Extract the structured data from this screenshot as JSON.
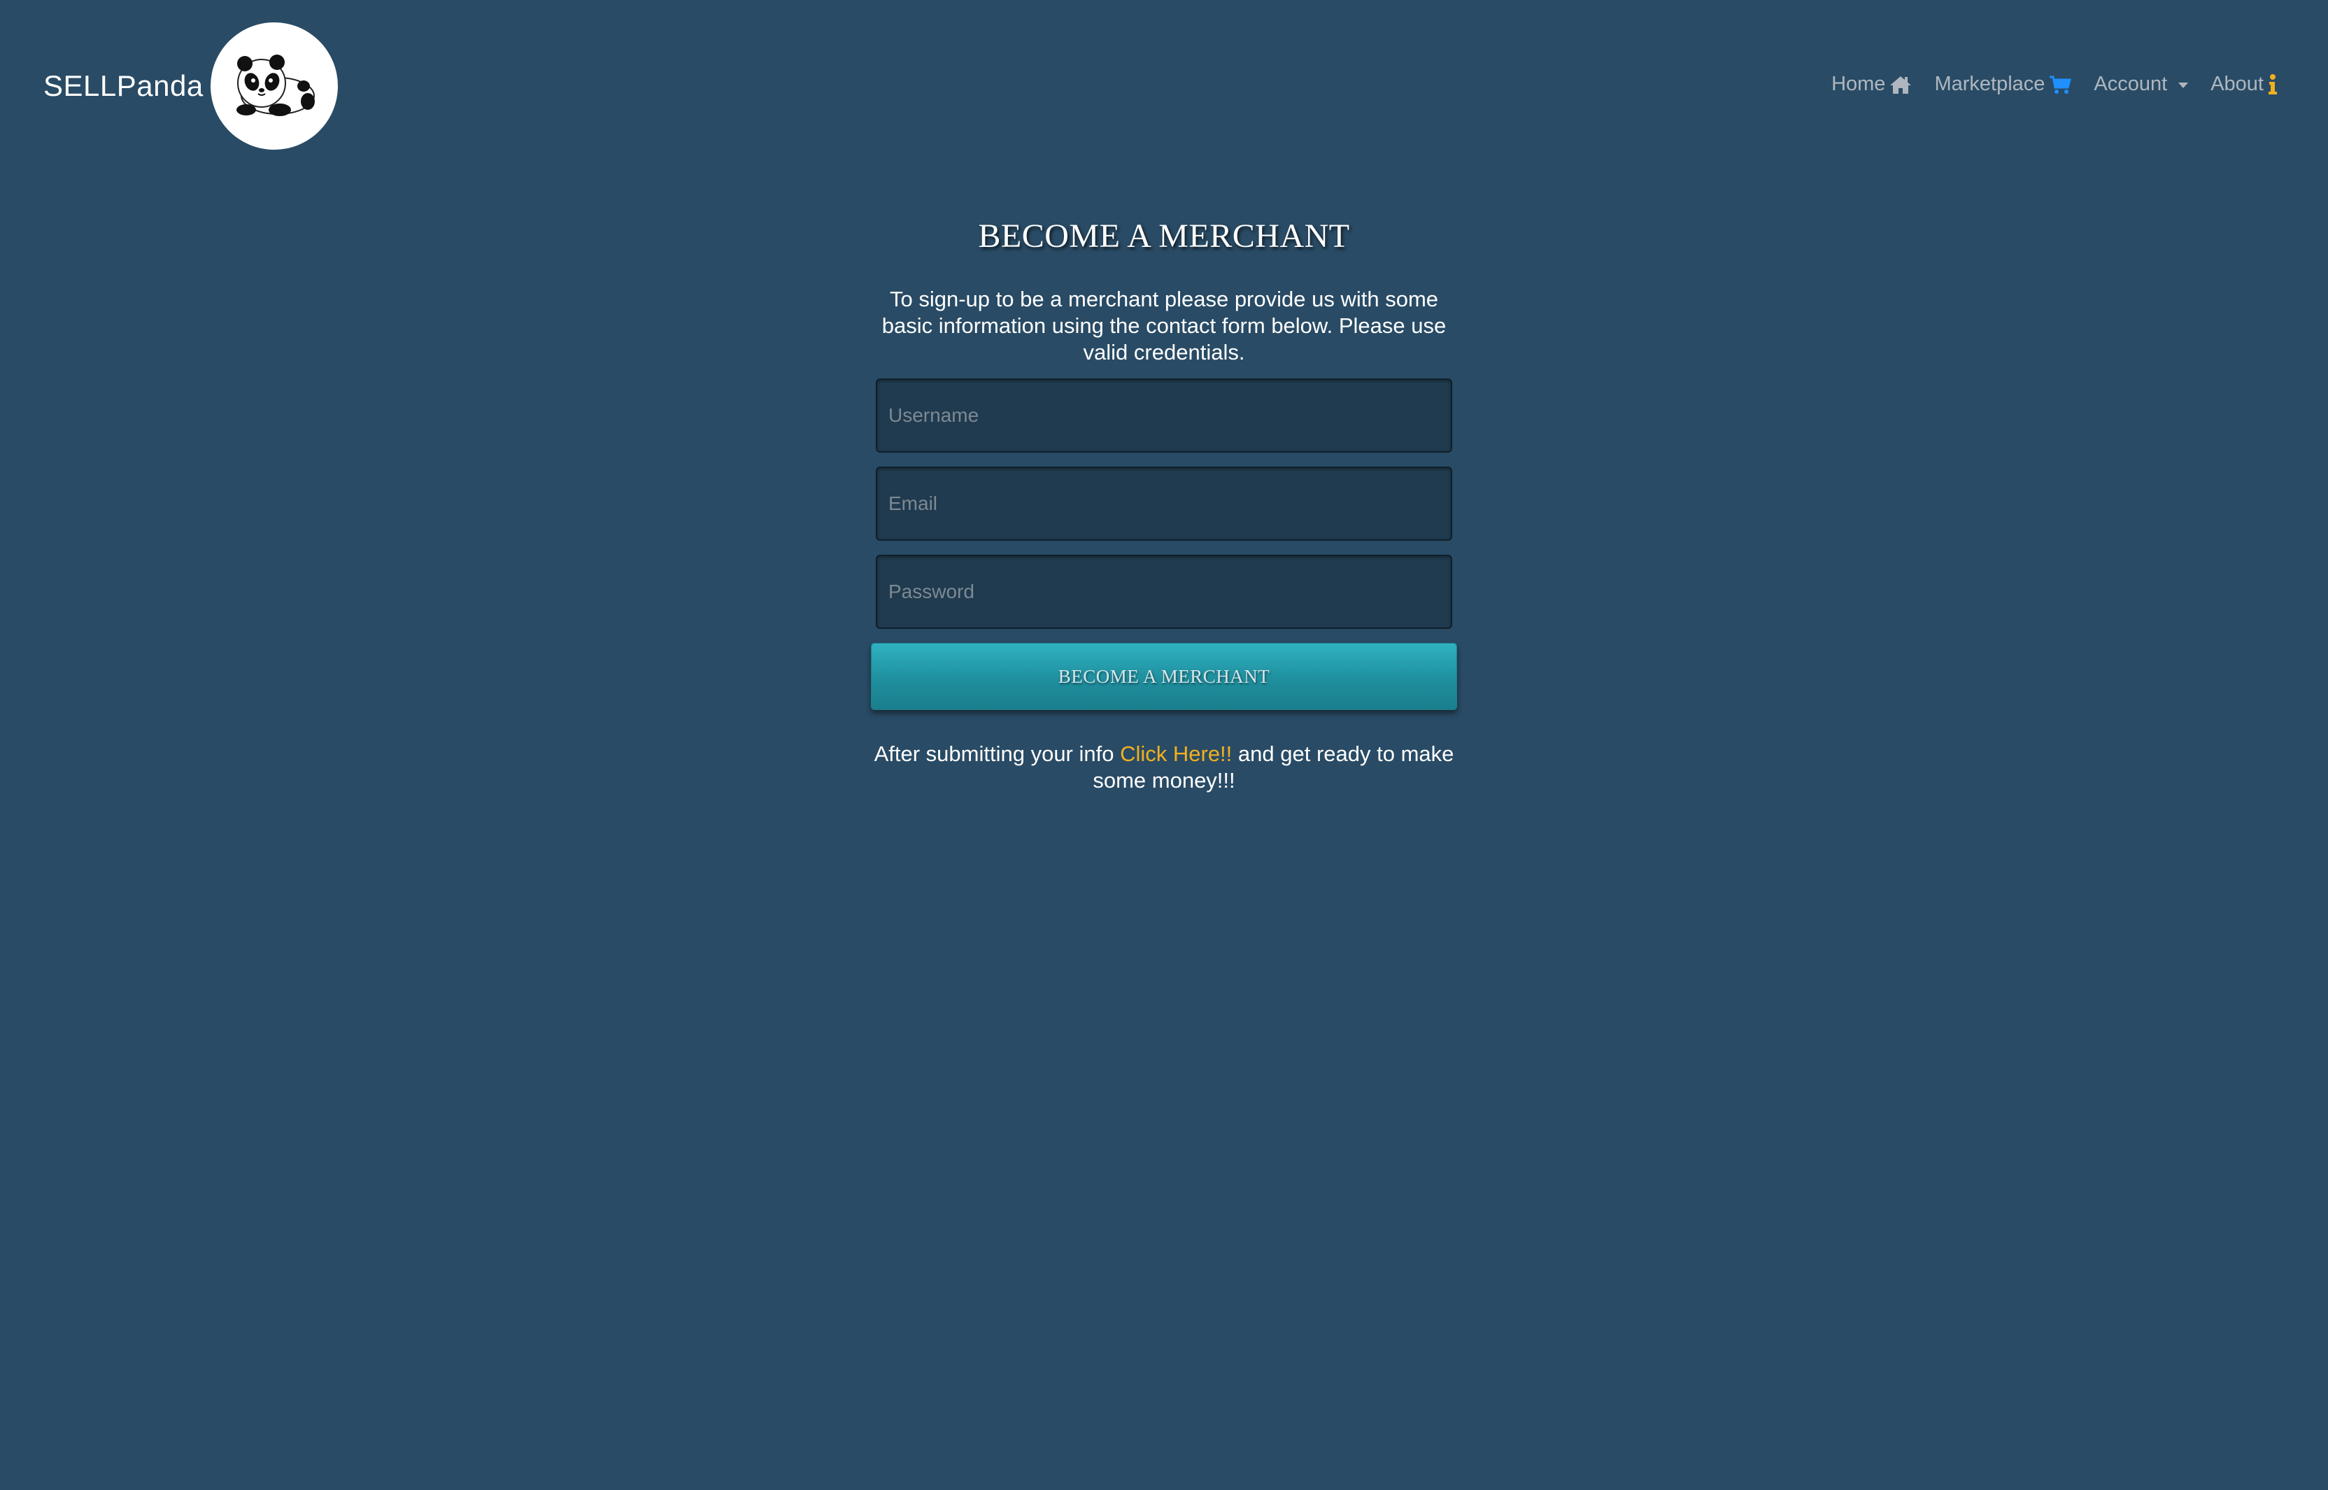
{
  "brand": {
    "name": "SELLPanda"
  },
  "nav": {
    "items": [
      {
        "label": "Home",
        "icon": "home-icon",
        "icon_color": "#aeb7bf"
      },
      {
        "label": "Marketplace",
        "icon": "cart-icon",
        "icon_color": "#1e90ff"
      },
      {
        "label": "Account",
        "icon": "caret-down-icon",
        "icon_color": "#aeb7bf"
      },
      {
        "label": "About",
        "icon": "info-icon",
        "icon_color": "#f2b01e"
      }
    ]
  },
  "main": {
    "title": "BECOME A MERCHANT",
    "intro": "To sign-up to be a merchant please provide us with some basic information using the contact form below. Please use valid credentials.",
    "form": {
      "username_placeholder": "Username",
      "email_placeholder": "Email",
      "password_placeholder": "Password",
      "submit_label": "BECOME A MERCHANT"
    },
    "after": {
      "before_link": "After submitting your info ",
      "link_text": "Click Here!!",
      "after_link": " and get ready to make some money!!!"
    }
  },
  "colors": {
    "background": "#294b65",
    "accent_link": "#f2b01e",
    "button": "#2fb2c2"
  }
}
